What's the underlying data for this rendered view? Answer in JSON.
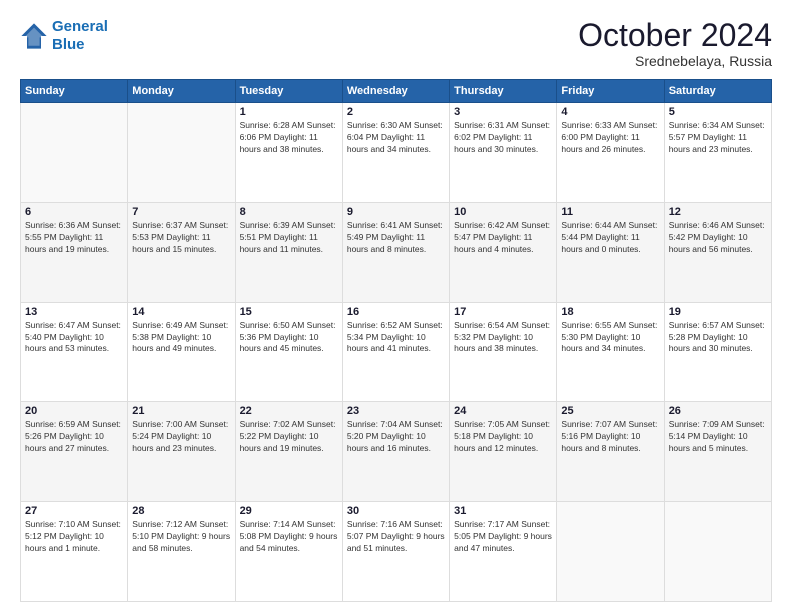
{
  "header": {
    "logo_line1": "General",
    "logo_line2": "Blue",
    "month": "October 2024",
    "location": "Srednebelaya, Russia"
  },
  "weekdays": [
    "Sunday",
    "Monday",
    "Tuesday",
    "Wednesday",
    "Thursday",
    "Friday",
    "Saturday"
  ],
  "weeks": [
    [
      {
        "day": "",
        "info": ""
      },
      {
        "day": "",
        "info": ""
      },
      {
        "day": "1",
        "info": "Sunrise: 6:28 AM\nSunset: 6:06 PM\nDaylight: 11 hours and 38 minutes."
      },
      {
        "day": "2",
        "info": "Sunrise: 6:30 AM\nSunset: 6:04 PM\nDaylight: 11 hours and 34 minutes."
      },
      {
        "day": "3",
        "info": "Sunrise: 6:31 AM\nSunset: 6:02 PM\nDaylight: 11 hours and 30 minutes."
      },
      {
        "day": "4",
        "info": "Sunrise: 6:33 AM\nSunset: 6:00 PM\nDaylight: 11 hours and 26 minutes."
      },
      {
        "day": "5",
        "info": "Sunrise: 6:34 AM\nSunset: 5:57 PM\nDaylight: 11 hours and 23 minutes."
      }
    ],
    [
      {
        "day": "6",
        "info": "Sunrise: 6:36 AM\nSunset: 5:55 PM\nDaylight: 11 hours and 19 minutes."
      },
      {
        "day": "7",
        "info": "Sunrise: 6:37 AM\nSunset: 5:53 PM\nDaylight: 11 hours and 15 minutes."
      },
      {
        "day": "8",
        "info": "Sunrise: 6:39 AM\nSunset: 5:51 PM\nDaylight: 11 hours and 11 minutes."
      },
      {
        "day": "9",
        "info": "Sunrise: 6:41 AM\nSunset: 5:49 PM\nDaylight: 11 hours and 8 minutes."
      },
      {
        "day": "10",
        "info": "Sunrise: 6:42 AM\nSunset: 5:47 PM\nDaylight: 11 hours and 4 minutes."
      },
      {
        "day": "11",
        "info": "Sunrise: 6:44 AM\nSunset: 5:44 PM\nDaylight: 11 hours and 0 minutes."
      },
      {
        "day": "12",
        "info": "Sunrise: 6:46 AM\nSunset: 5:42 PM\nDaylight: 10 hours and 56 minutes."
      }
    ],
    [
      {
        "day": "13",
        "info": "Sunrise: 6:47 AM\nSunset: 5:40 PM\nDaylight: 10 hours and 53 minutes."
      },
      {
        "day": "14",
        "info": "Sunrise: 6:49 AM\nSunset: 5:38 PM\nDaylight: 10 hours and 49 minutes."
      },
      {
        "day": "15",
        "info": "Sunrise: 6:50 AM\nSunset: 5:36 PM\nDaylight: 10 hours and 45 minutes."
      },
      {
        "day": "16",
        "info": "Sunrise: 6:52 AM\nSunset: 5:34 PM\nDaylight: 10 hours and 41 minutes."
      },
      {
        "day": "17",
        "info": "Sunrise: 6:54 AM\nSunset: 5:32 PM\nDaylight: 10 hours and 38 minutes."
      },
      {
        "day": "18",
        "info": "Sunrise: 6:55 AM\nSunset: 5:30 PM\nDaylight: 10 hours and 34 minutes."
      },
      {
        "day": "19",
        "info": "Sunrise: 6:57 AM\nSunset: 5:28 PM\nDaylight: 10 hours and 30 minutes."
      }
    ],
    [
      {
        "day": "20",
        "info": "Sunrise: 6:59 AM\nSunset: 5:26 PM\nDaylight: 10 hours and 27 minutes."
      },
      {
        "day": "21",
        "info": "Sunrise: 7:00 AM\nSunset: 5:24 PM\nDaylight: 10 hours and 23 minutes."
      },
      {
        "day": "22",
        "info": "Sunrise: 7:02 AM\nSunset: 5:22 PM\nDaylight: 10 hours and 19 minutes."
      },
      {
        "day": "23",
        "info": "Sunrise: 7:04 AM\nSunset: 5:20 PM\nDaylight: 10 hours and 16 minutes."
      },
      {
        "day": "24",
        "info": "Sunrise: 7:05 AM\nSunset: 5:18 PM\nDaylight: 10 hours and 12 minutes."
      },
      {
        "day": "25",
        "info": "Sunrise: 7:07 AM\nSunset: 5:16 PM\nDaylight: 10 hours and 8 minutes."
      },
      {
        "day": "26",
        "info": "Sunrise: 7:09 AM\nSunset: 5:14 PM\nDaylight: 10 hours and 5 minutes."
      }
    ],
    [
      {
        "day": "27",
        "info": "Sunrise: 7:10 AM\nSunset: 5:12 PM\nDaylight: 10 hours and 1 minute."
      },
      {
        "day": "28",
        "info": "Sunrise: 7:12 AM\nSunset: 5:10 PM\nDaylight: 9 hours and 58 minutes."
      },
      {
        "day": "29",
        "info": "Sunrise: 7:14 AM\nSunset: 5:08 PM\nDaylight: 9 hours and 54 minutes."
      },
      {
        "day": "30",
        "info": "Sunrise: 7:16 AM\nSunset: 5:07 PM\nDaylight: 9 hours and 51 minutes."
      },
      {
        "day": "31",
        "info": "Sunrise: 7:17 AM\nSunset: 5:05 PM\nDaylight: 9 hours and 47 minutes."
      },
      {
        "day": "",
        "info": ""
      },
      {
        "day": "",
        "info": ""
      }
    ]
  ]
}
